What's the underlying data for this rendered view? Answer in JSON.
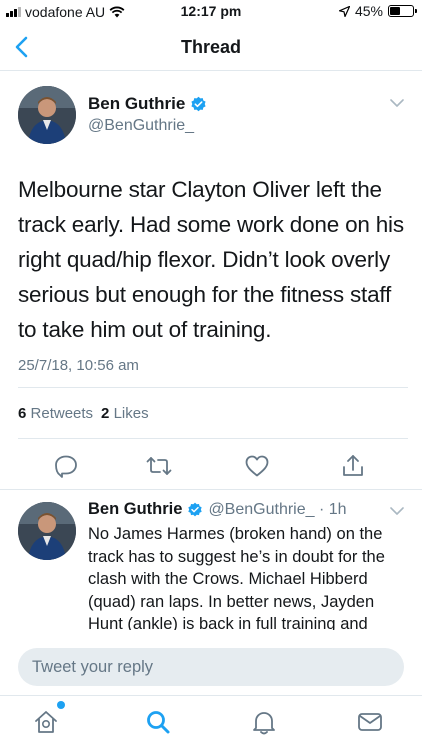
{
  "status_bar": {
    "carrier": "vodafone AU",
    "time": "12:17 pm",
    "battery": "45%",
    "battery_level": 0.45
  },
  "nav": {
    "title": "Thread"
  },
  "main_tweet": {
    "author_name": "Ben Guthrie",
    "author_handle": "@BenGuthrie_",
    "text": "Melbourne star Clayton Oliver left the track early. Had some work done on his right quad/hip flexor. Didn’t look overly serious but enough for the fitness staff to take him out of training.",
    "date": "25/7/18, 10:56 am",
    "retweets_count": "6",
    "retweets_label": "Retweets",
    "likes_count": "2",
    "likes_label": "Likes"
  },
  "reply_tweet": {
    "author_name": "Ben Guthrie",
    "meta": "@BenGuthrie_ · 1h",
    "text": "No James Harmes (broken hand) on the track has to suggest he’s in doubt for the clash with the Crows. Michael Hibberd (quad) ran laps. In better news, Jayden Hunt (ankle) is back in full training and moving well."
  },
  "composer": {
    "placeholder": "Tweet your reply"
  },
  "colors": {
    "accent": "#1da1f2",
    "text_secondary": "#657786",
    "divider": "#e1e8ed",
    "input_bg": "#e6ecf0"
  },
  "icons": {
    "back": "chevron-left-icon",
    "verified": "verified-badge-icon",
    "reply": "comment-icon",
    "retweet": "retweet-icon",
    "like": "heart-icon",
    "share": "share-icon",
    "home": "home-icon",
    "search": "search-icon",
    "notifications": "bell-icon",
    "messages": "mail-icon"
  }
}
